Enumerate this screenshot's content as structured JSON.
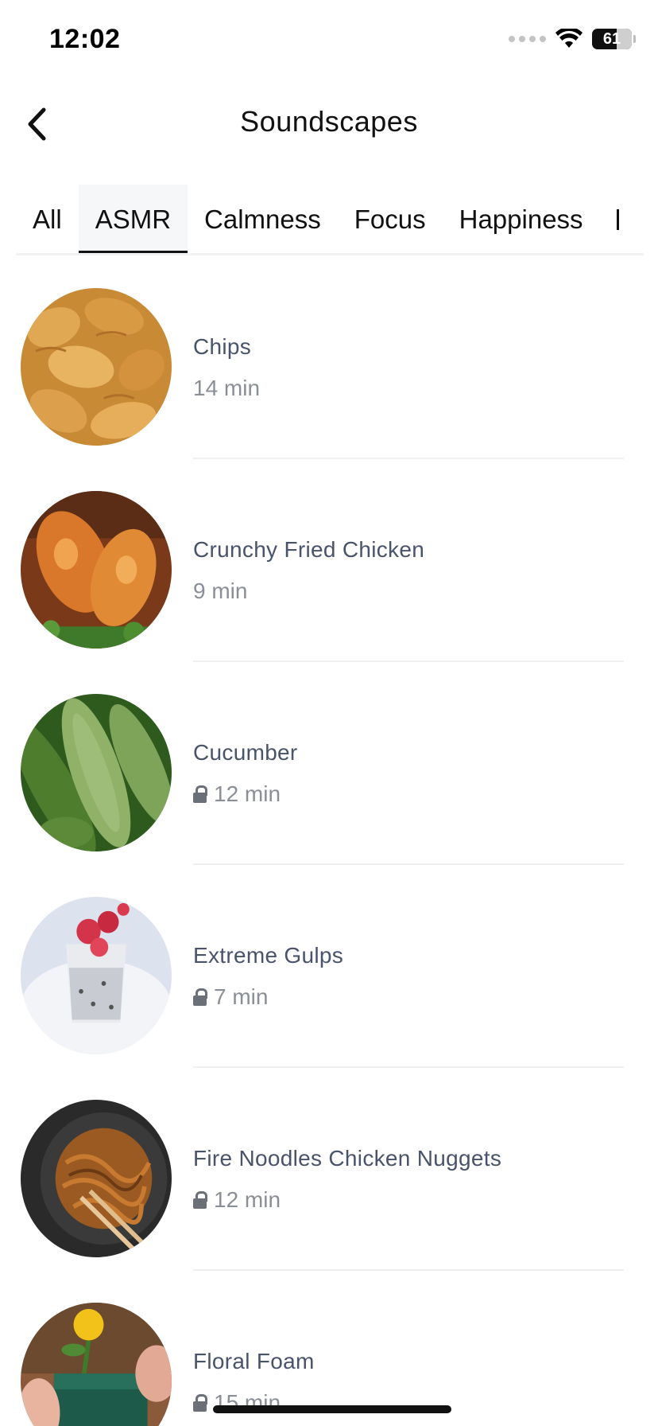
{
  "status_bar": {
    "time": "12:02",
    "battery_level": "61",
    "battery_fraction": 0.61,
    "icons": [
      "signal-dots-icon",
      "wifi-icon",
      "battery-icon"
    ]
  },
  "nav": {
    "title": "Soundscapes",
    "back_icon": "chevron-left-icon"
  },
  "tabs": {
    "items": [
      {
        "label": "All",
        "active": false
      },
      {
        "label": "ASMR",
        "active": true
      },
      {
        "label": "Calmness",
        "active": false
      },
      {
        "label": "Focus",
        "active": false
      },
      {
        "label": "Happiness",
        "active": false
      }
    ]
  },
  "list": {
    "items": [
      {
        "title": "Chips",
        "duration": "14 min",
        "locked": false
      },
      {
        "title": "Crunchy Fried Chicken",
        "duration": "9 min",
        "locked": false
      },
      {
        "title": "Cucumber",
        "duration": "12 min",
        "locked": true
      },
      {
        "title": "Extreme Gulps",
        "duration": "7 min",
        "locked": true
      },
      {
        "title": "Fire Noodles Chicken Nuggets",
        "duration": "12 min",
        "locked": true
      },
      {
        "title": "Floral Foam",
        "duration": "15 min",
        "locked": true
      }
    ]
  },
  "colors": {
    "title_text": "#49536a",
    "meta_text": "#8a8e96",
    "active_tab_bg": "#f6f7f9",
    "active_tab_underline": "#111111"
  }
}
